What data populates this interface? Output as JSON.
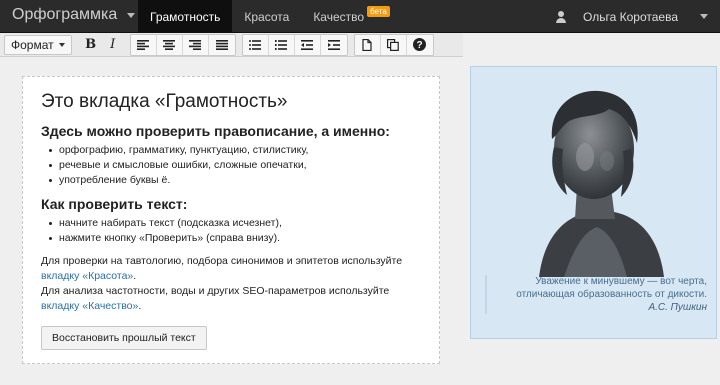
{
  "navbar": {
    "brand": "Орфограммка",
    "tabs": [
      {
        "label": "Грамотность"
      },
      {
        "label": "Красота"
      },
      {
        "label": "Качество",
        "badge": "бета"
      }
    ],
    "user_name": "Ольга Коротаева"
  },
  "toolbar": {
    "format_label": "Формат",
    "bold": "B",
    "italic": "I"
  },
  "card": {
    "title": "Это вкладка «Грамотность»",
    "subtitle1": "Здесь можно проверить правописание, а именно:",
    "list1": [
      "орфографию, грамматику, пунктуацию, стилистику,",
      "речевые и смысловые ошибки, сложные опечатки,",
      "употребление буквы ё."
    ],
    "subtitle2": "Как проверить текст:",
    "list2": [
      "начните набирать текст (подсказка исчезнет),",
      "нажмите кнопку «Проверить» (справа внизу)."
    ],
    "para1_text": "Для проверки на тавтологию, подбора синонимов и эпитетов используйте",
    "para1_link": "вкладку «Красота»",
    "para2_text": "Для анализа частотности, воды и других SEO-параметров используйте",
    "para2_link": "вкладку «Качество»",
    "restore_button": "Восстановить прошлый текст"
  },
  "quote": {
    "line1": "Уважение к минувшему — вот черта,",
    "line2": "отличающая образованность от дикости.",
    "author": "А.С. Пушкин"
  }
}
